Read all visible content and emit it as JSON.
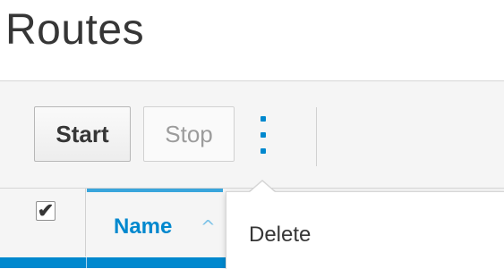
{
  "page": {
    "title": "Routes"
  },
  "toolbar": {
    "start_label": "Start",
    "stop_label": "Stop",
    "kebab_icon": "kebab-vertical-icon"
  },
  "table": {
    "columns": [
      {
        "label": "Name",
        "sort": "ascending",
        "sort_icon": "^"
      }
    ],
    "select_all_checked": true,
    "check_glyph": "✔"
  },
  "menu": {
    "items": [
      {
        "label": "Delete"
      }
    ]
  },
  "colors": {
    "accent": "#0088ce",
    "active_border": "#39a5dc",
    "text": "#363636",
    "disabled_text": "#9c9c9c"
  }
}
